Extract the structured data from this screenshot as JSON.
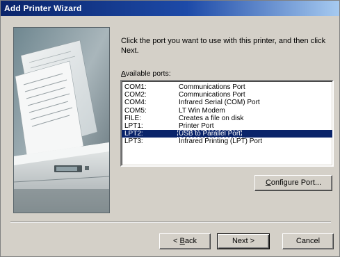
{
  "window": {
    "title": "Add Printer Wizard"
  },
  "instruction": "Click the port you want to use with this printer, and then click Next.",
  "ports_label": {
    "accel": "A",
    "rest": "vailable ports:"
  },
  "ports": [
    {
      "name": "COM1:",
      "desc": "Communications Port"
    },
    {
      "name": "COM2:",
      "desc": "Communications Port"
    },
    {
      "name": "COM4:",
      "desc": "Infrared Serial (COM) Port"
    },
    {
      "name": "COM5:",
      "desc": "LT Win Modem"
    },
    {
      "name": "FILE:",
      "desc": "Creates a file on disk"
    },
    {
      "name": "LPT1:",
      "desc": "Printer Port"
    },
    {
      "name": "LPT2:",
      "desc": "USB to Parallel Port"
    },
    {
      "name": "LPT3:",
      "desc": "Infrared Printing (LPT) Port"
    }
  ],
  "selected_port_index": 6,
  "buttons": {
    "configure": {
      "accel": "C",
      "rest": "onfigure Port..."
    },
    "back": {
      "prefix": "< ",
      "accel": "B",
      "rest": "ack"
    },
    "next": "Next >",
    "cancel": "Cancel"
  },
  "colors": {
    "titlebar_start": "#0a246a",
    "titlebar_end": "#a6caf0",
    "selection": "#0a246a",
    "dialog_face": "#d4d0c8"
  },
  "icons": {
    "wizard_art": "printer-with-paper-illustration"
  }
}
